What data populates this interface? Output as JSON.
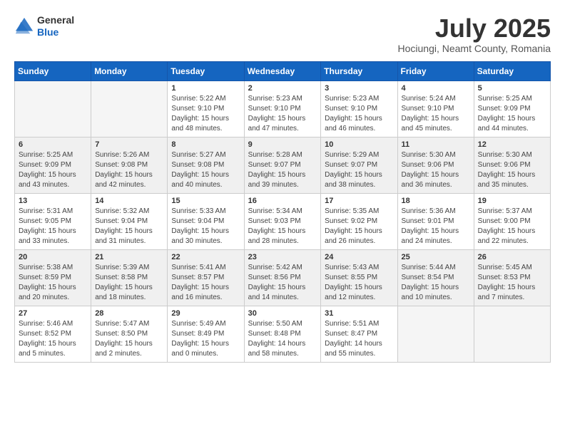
{
  "header": {
    "logo_general": "General",
    "logo_blue": "Blue",
    "month_title": "July 2025",
    "location": "Hociungi, Neamt County, Romania"
  },
  "weekdays": [
    "Sunday",
    "Monday",
    "Tuesday",
    "Wednesday",
    "Thursday",
    "Friday",
    "Saturday"
  ],
  "weeks": [
    [
      {
        "day": "",
        "sunrise": "",
        "sunset": "",
        "daylight": ""
      },
      {
        "day": "",
        "sunrise": "",
        "sunset": "",
        "daylight": ""
      },
      {
        "day": "1",
        "sunrise": "Sunrise: 5:22 AM",
        "sunset": "Sunset: 9:10 PM",
        "daylight": "Daylight: 15 hours and 48 minutes."
      },
      {
        "day": "2",
        "sunrise": "Sunrise: 5:23 AM",
        "sunset": "Sunset: 9:10 PM",
        "daylight": "Daylight: 15 hours and 47 minutes."
      },
      {
        "day": "3",
        "sunrise": "Sunrise: 5:23 AM",
        "sunset": "Sunset: 9:10 PM",
        "daylight": "Daylight: 15 hours and 46 minutes."
      },
      {
        "day": "4",
        "sunrise": "Sunrise: 5:24 AM",
        "sunset": "Sunset: 9:10 PM",
        "daylight": "Daylight: 15 hours and 45 minutes."
      },
      {
        "day": "5",
        "sunrise": "Sunrise: 5:25 AM",
        "sunset": "Sunset: 9:09 PM",
        "daylight": "Daylight: 15 hours and 44 minutes."
      }
    ],
    [
      {
        "day": "6",
        "sunrise": "Sunrise: 5:25 AM",
        "sunset": "Sunset: 9:09 PM",
        "daylight": "Daylight: 15 hours and 43 minutes."
      },
      {
        "day": "7",
        "sunrise": "Sunrise: 5:26 AM",
        "sunset": "Sunset: 9:08 PM",
        "daylight": "Daylight: 15 hours and 42 minutes."
      },
      {
        "day": "8",
        "sunrise": "Sunrise: 5:27 AM",
        "sunset": "Sunset: 9:08 PM",
        "daylight": "Daylight: 15 hours and 40 minutes."
      },
      {
        "day": "9",
        "sunrise": "Sunrise: 5:28 AM",
        "sunset": "Sunset: 9:07 PM",
        "daylight": "Daylight: 15 hours and 39 minutes."
      },
      {
        "day": "10",
        "sunrise": "Sunrise: 5:29 AM",
        "sunset": "Sunset: 9:07 PM",
        "daylight": "Daylight: 15 hours and 38 minutes."
      },
      {
        "day": "11",
        "sunrise": "Sunrise: 5:30 AM",
        "sunset": "Sunset: 9:06 PM",
        "daylight": "Daylight: 15 hours and 36 minutes."
      },
      {
        "day": "12",
        "sunrise": "Sunrise: 5:30 AM",
        "sunset": "Sunset: 9:06 PM",
        "daylight": "Daylight: 15 hours and 35 minutes."
      }
    ],
    [
      {
        "day": "13",
        "sunrise": "Sunrise: 5:31 AM",
        "sunset": "Sunset: 9:05 PM",
        "daylight": "Daylight: 15 hours and 33 minutes."
      },
      {
        "day": "14",
        "sunrise": "Sunrise: 5:32 AM",
        "sunset": "Sunset: 9:04 PM",
        "daylight": "Daylight: 15 hours and 31 minutes."
      },
      {
        "day": "15",
        "sunrise": "Sunrise: 5:33 AM",
        "sunset": "Sunset: 9:04 PM",
        "daylight": "Daylight: 15 hours and 30 minutes."
      },
      {
        "day": "16",
        "sunrise": "Sunrise: 5:34 AM",
        "sunset": "Sunset: 9:03 PM",
        "daylight": "Daylight: 15 hours and 28 minutes."
      },
      {
        "day": "17",
        "sunrise": "Sunrise: 5:35 AM",
        "sunset": "Sunset: 9:02 PM",
        "daylight": "Daylight: 15 hours and 26 minutes."
      },
      {
        "day": "18",
        "sunrise": "Sunrise: 5:36 AM",
        "sunset": "Sunset: 9:01 PM",
        "daylight": "Daylight: 15 hours and 24 minutes."
      },
      {
        "day": "19",
        "sunrise": "Sunrise: 5:37 AM",
        "sunset": "Sunset: 9:00 PM",
        "daylight": "Daylight: 15 hours and 22 minutes."
      }
    ],
    [
      {
        "day": "20",
        "sunrise": "Sunrise: 5:38 AM",
        "sunset": "Sunset: 8:59 PM",
        "daylight": "Daylight: 15 hours and 20 minutes."
      },
      {
        "day": "21",
        "sunrise": "Sunrise: 5:39 AM",
        "sunset": "Sunset: 8:58 PM",
        "daylight": "Daylight: 15 hours and 18 minutes."
      },
      {
        "day": "22",
        "sunrise": "Sunrise: 5:41 AM",
        "sunset": "Sunset: 8:57 PM",
        "daylight": "Daylight: 15 hours and 16 minutes."
      },
      {
        "day": "23",
        "sunrise": "Sunrise: 5:42 AM",
        "sunset": "Sunset: 8:56 PM",
        "daylight": "Daylight: 15 hours and 14 minutes."
      },
      {
        "day": "24",
        "sunrise": "Sunrise: 5:43 AM",
        "sunset": "Sunset: 8:55 PM",
        "daylight": "Daylight: 15 hours and 12 minutes."
      },
      {
        "day": "25",
        "sunrise": "Sunrise: 5:44 AM",
        "sunset": "Sunset: 8:54 PM",
        "daylight": "Daylight: 15 hours and 10 minutes."
      },
      {
        "day": "26",
        "sunrise": "Sunrise: 5:45 AM",
        "sunset": "Sunset: 8:53 PM",
        "daylight": "Daylight: 15 hours and 7 minutes."
      }
    ],
    [
      {
        "day": "27",
        "sunrise": "Sunrise: 5:46 AM",
        "sunset": "Sunset: 8:52 PM",
        "daylight": "Daylight: 15 hours and 5 minutes."
      },
      {
        "day": "28",
        "sunrise": "Sunrise: 5:47 AM",
        "sunset": "Sunset: 8:50 PM",
        "daylight": "Daylight: 15 hours and 2 minutes."
      },
      {
        "day": "29",
        "sunrise": "Sunrise: 5:49 AM",
        "sunset": "Sunset: 8:49 PM",
        "daylight": "Daylight: 15 hours and 0 minutes."
      },
      {
        "day": "30",
        "sunrise": "Sunrise: 5:50 AM",
        "sunset": "Sunset: 8:48 PM",
        "daylight": "Daylight: 14 hours and 58 minutes."
      },
      {
        "day": "31",
        "sunrise": "Sunrise: 5:51 AM",
        "sunset": "Sunset: 8:47 PM",
        "daylight": "Daylight: 14 hours and 55 minutes."
      },
      {
        "day": "",
        "sunrise": "",
        "sunset": "",
        "daylight": ""
      },
      {
        "day": "",
        "sunrise": "",
        "sunset": "",
        "daylight": ""
      }
    ]
  ]
}
